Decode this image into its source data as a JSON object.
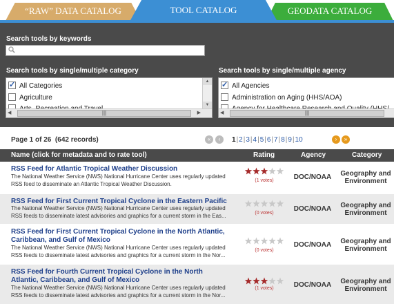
{
  "tabs": [
    {
      "label": "“RAW” DATA CATALOG"
    },
    {
      "label": "TOOL CATALOG"
    },
    {
      "label": "GEODATA CATALOG"
    }
  ],
  "search": {
    "keywords_label": "Search tools by keywords",
    "keywords_value": "",
    "category_label": "Search tools by single/multiple category",
    "agency_label": "Search tools by single/multiple agency"
  },
  "categories": [
    {
      "label": "All Categories",
      "checked": true
    },
    {
      "label": "Agriculture",
      "checked": false
    },
    {
      "label": "Arts, Recreation and Travel",
      "checked": false
    }
  ],
  "agencies": [
    {
      "label": "All Agencies",
      "checked": true
    },
    {
      "label": "Administration on Aging (HHS/AOA)",
      "checked": false
    },
    {
      "label": "Agency for Healthcare Research and Quality (HHS/",
      "checked": false
    }
  ],
  "pager": {
    "page_label": "Page 1 of 26",
    "records_label": "(642 records)",
    "pages": [
      "1",
      "2",
      "3",
      "4",
      "5",
      "6",
      "7",
      "8",
      "9",
      "10"
    ],
    "current": "1"
  },
  "table": {
    "headers": {
      "name": "Name (click for metadata and to rate tool)",
      "rating": "Rating",
      "agency": "Agency",
      "category": "Category"
    },
    "rows": [
      {
        "name": "RSS Feed for Atlantic Tropical Weather Discussion",
        "desc": "The National Weather Service (NWS) National Hurricane Center uses regularly updated RSS feed to disseminate an Atlantic Tropical Weather Discussion.",
        "rating": 3,
        "votes": "(1 votes)",
        "agency": "DOC/NOAA",
        "category": "Geography and Environment"
      },
      {
        "name": "RSS Feed for First Current Tropical Cyclone in the Eastern Pacific",
        "desc": "The National Weather Service (NWS) National Hurricane Center uses regularly updated RSS feeds to disseminate latest advisories and graphics for a current storm in the Eas...",
        "rating": 0,
        "votes": "(0 votes)",
        "agency": "DOC/NOAA",
        "category": "Geography and Environment"
      },
      {
        "name": "RSS Feed for First Current Tropical Cyclone in the North Atlantic, Caribbean, and Gulf of Mexico",
        "desc": "The National Weather Service (NWS) National Hurricane Center uses regularly updated RSS feeds to disseminate latest advisories and graphics for a current storm in the Nor...",
        "rating": 0,
        "votes": "(0 votes)",
        "agency": "DOC/NOAA",
        "category": "Geography and Environment"
      },
      {
        "name": "RSS Feed for Fourth Current Tropical Cyclone in the North Atlantic, Caribbean, and Gulf of Mexico",
        "desc": "The National Weather Service (NWS) National Hurricane Center uses regularly updated RSS feeds to disseminate latest advisories and graphics for a current storm in the Nor...",
        "rating": 3,
        "votes": "(1 votes)",
        "agency": "DOC/NOAA",
        "category": "Geography and Environment"
      }
    ]
  },
  "colors": {
    "raw_tab": "#d7ab6a",
    "tool_tab": "#3c8fd4",
    "geo_tab": "#3cad3c",
    "star_on": "#a52a2a",
    "star_off": "#c8c8c8",
    "link": "#1e3f8a"
  }
}
